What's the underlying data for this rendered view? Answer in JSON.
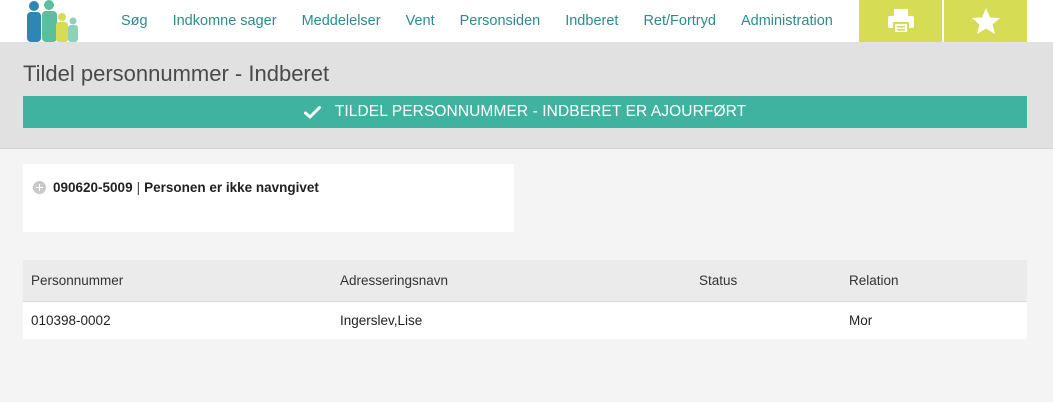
{
  "nav": {
    "items": [
      "Søg",
      "Indkomne sager",
      "Meddelelser",
      "Vent",
      "Personsiden",
      "Indberet",
      "Ret/Fortryd",
      "Administration"
    ]
  },
  "toolbar": {
    "print_icon": "printer-icon",
    "favorite_icon": "star-icon"
  },
  "page": {
    "title": "Tildel personnummer - Indberet",
    "banner": "TILDEL PERSONNUMMER - INDBERET ER AJOURFØRT"
  },
  "person": {
    "number": "090620-5009",
    "separator": "|",
    "status": "Personen er ikke navngivet"
  },
  "relations": {
    "headers": [
      "Personnummer",
      "Adresseringsnavn",
      "Status",
      "Relation"
    ],
    "rows": [
      {
        "personnummer": "010398-0002",
        "navn": "Ingerslev,Lise",
        "status": "",
        "relation": "Mor"
      }
    ]
  },
  "colors": {
    "accent_teal": "#3fb39f",
    "nav_link": "#2f8b8b",
    "action_yellow": "#d6dc53"
  }
}
